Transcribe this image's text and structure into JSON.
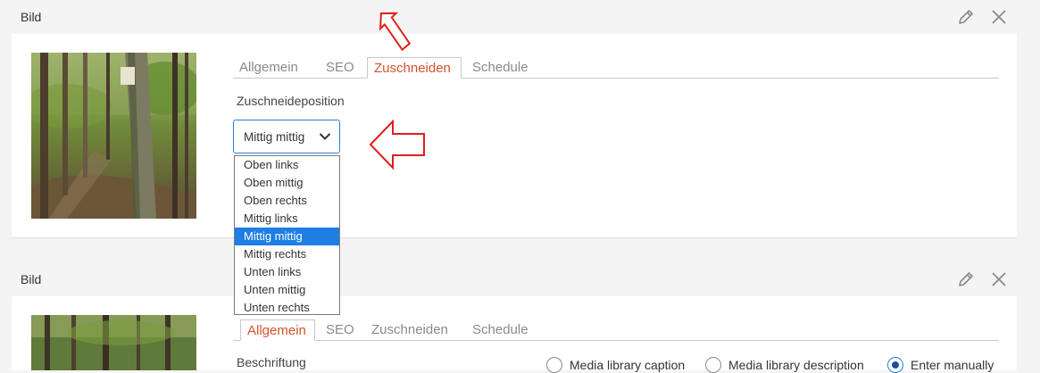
{
  "panels": [
    {
      "title": "Bild",
      "tabs": [
        "Allgemein",
        "SEO",
        "Zuschneiden",
        "Schedule"
      ],
      "active_tab": "Zuschneiden",
      "field_label": "Zuschneideposition",
      "select_value": "Mittig mittig",
      "dropdown_options": [
        "Oben links",
        "Oben mittig",
        "Oben rechts",
        "Mittig links",
        "Mittig mittig",
        "Mittig rechts",
        "Unten links",
        "Unten mittig",
        "Unten rechts"
      ],
      "selected_option": "Mittig mittig"
    },
    {
      "title": "Bild",
      "tabs": [
        "Allgemein",
        "SEO",
        "Zuschneiden",
        "Schedule"
      ],
      "active_tab": "Allgemein",
      "field_label": "Beschriftung",
      "radio_options": [
        "Media library caption",
        "Media library description",
        "Enter manually"
      ],
      "radio_selected": "Enter manually"
    }
  ],
  "icons": {
    "edit": "pencil-icon",
    "close": "close-icon",
    "dropdown": "chevron-down-icon",
    "annotation": "red-outline-arrow-icon"
  },
  "colors": {
    "active_tab": "#d2522e",
    "focus_border": "#2b7fd1",
    "selected_option_bg": "#1e7ee6",
    "annotation_arrow": "#e0201c"
  }
}
